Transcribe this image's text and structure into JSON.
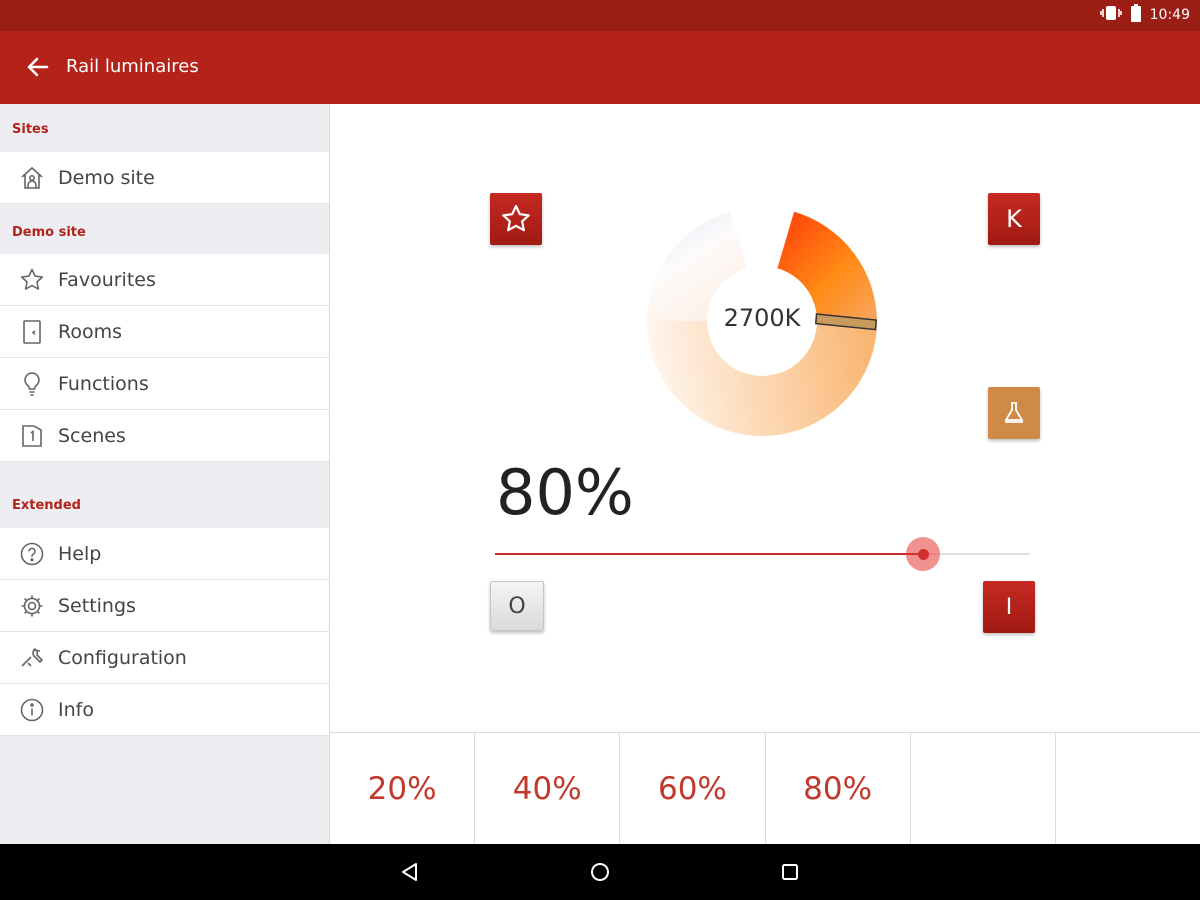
{
  "status_bar": {
    "time": "10:49",
    "icons": [
      "vibrate-icon",
      "battery-icon"
    ],
    "color": "#9a1e14"
  },
  "app_bar": {
    "title": "Rail luminaires",
    "back_icon": "arrow-left-icon",
    "color": "#b3231a"
  },
  "sidebar": {
    "sections": [
      {
        "title": "Sites",
        "items": [
          {
            "label": "Demo site",
            "icon": "home-icon"
          }
        ]
      },
      {
        "title": "Demo site",
        "items": [
          {
            "label": "Favourites",
            "icon": "star-icon"
          },
          {
            "label": "Rooms",
            "icon": "door-icon"
          },
          {
            "label": "Functions",
            "icon": "lightbulb-icon"
          },
          {
            "label": "Scenes",
            "icon": "scene-icon"
          }
        ]
      },
      {
        "title": "Extended",
        "items": [
          {
            "label": "Help",
            "icon": "help-icon"
          },
          {
            "label": "Settings",
            "icon": "gear-icon"
          },
          {
            "label": "Configuration",
            "icon": "wrench-icon"
          },
          {
            "label": "Info",
            "icon": "info-icon"
          }
        ]
      }
    ]
  },
  "control": {
    "favourite_icon": "star-icon",
    "kelvin_button_label": "K",
    "lamp_icon": "lamp-icon",
    "color_temperature": "2700K",
    "brightness_label": "80%",
    "brightness_level": 0.8,
    "off_label": "O",
    "on_label": "I",
    "accent_color": "#c62828"
  },
  "presets": [
    "20%",
    "40%",
    "60%",
    "80%",
    "",
    ""
  ],
  "nav_bar": {
    "icons": [
      "back-triangle-icon",
      "home-circle-icon",
      "recents-square-icon"
    ]
  }
}
